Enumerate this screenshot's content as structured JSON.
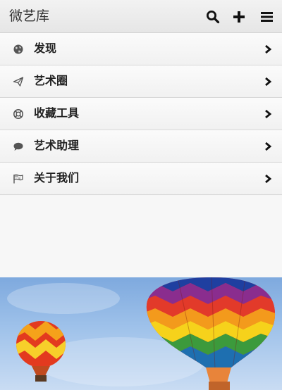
{
  "header": {
    "title": "微艺库",
    "search_icon": "search-icon",
    "add_icon": "plus-icon",
    "menu_icon": "hamburger-menu-icon"
  },
  "menu": {
    "items": [
      {
        "label": "发现",
        "icon": "globe-icon"
      },
      {
        "label": "艺术圈",
        "icon": "paper-plane-icon"
      },
      {
        "label": "收藏工具",
        "icon": "lifebuoy-icon"
      },
      {
        "label": "艺术助理",
        "icon": "chat-bubble-icon"
      },
      {
        "label": "关于我们",
        "icon": "flag-icon"
      }
    ]
  },
  "banner": {
    "image": "hot-air-balloons"
  },
  "colors": {
    "header_bg": "#ececec",
    "text": "#222222",
    "sky": "#8fb7e6"
  }
}
